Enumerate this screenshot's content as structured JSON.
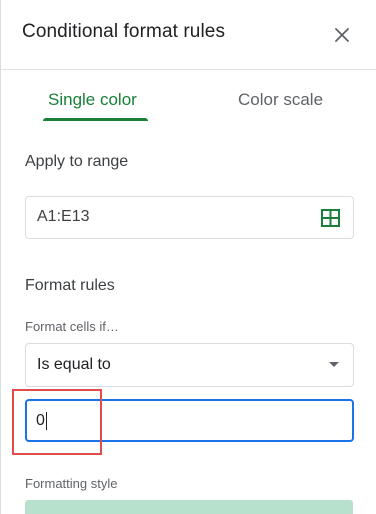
{
  "header": {
    "title": "Conditional format rules",
    "close_icon": "close-icon"
  },
  "tabs": [
    {
      "label": "Single color",
      "active": true
    },
    {
      "label": "Color scale",
      "active": false
    }
  ],
  "apply_to_range": {
    "label": "Apply to range",
    "value": "A1:E13",
    "icon": "grid-select-icon"
  },
  "format_rules": {
    "label": "Format rules",
    "condition_label": "Format cells if…",
    "condition_value": "Is equal to",
    "value_input": "0"
  },
  "formatting_style": {
    "label": "Formatting style",
    "preview_color": "#b7e1cd"
  },
  "colors": {
    "accent_green": "#188038",
    "focus_blue": "#1a73e8",
    "annotation_red": "#e14b4b"
  }
}
